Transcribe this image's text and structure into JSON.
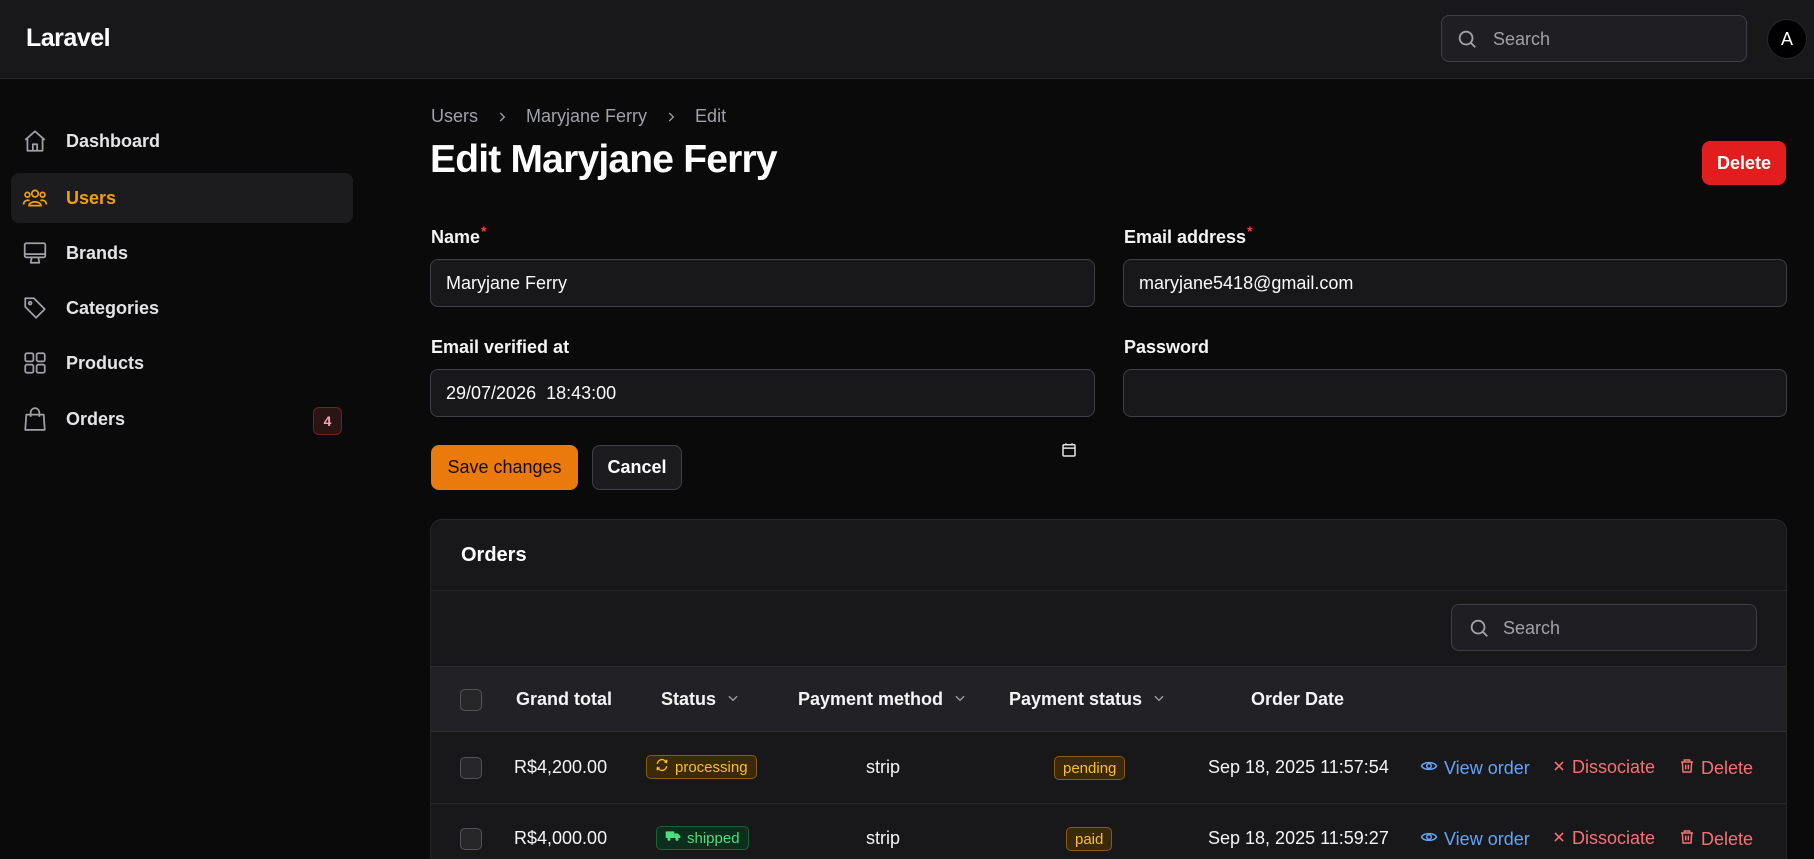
{
  "header": {
    "brand": "Laravel",
    "search_placeholder": "Search",
    "avatar_initial": "A"
  },
  "sidebar": {
    "items": [
      {
        "label": "Dashboard",
        "icon": "home-icon",
        "active": false
      },
      {
        "label": "Users",
        "icon": "users-icon",
        "active": true
      },
      {
        "label": "Brands",
        "icon": "monitor-icon",
        "active": false
      },
      {
        "label": "Categories",
        "icon": "tag-icon",
        "active": false
      },
      {
        "label": "Products",
        "icon": "grid-icon",
        "active": false
      },
      {
        "label": "Orders",
        "icon": "shopping-bag-icon",
        "active": false,
        "badge": "4"
      }
    ]
  },
  "breadcrumb": [
    "Users",
    "Maryjane Ferry",
    "Edit"
  ],
  "page": {
    "title": "Edit Maryjane Ferry",
    "delete_label": "Delete"
  },
  "form": {
    "name_label": "Name",
    "name_value": "Maryjane Ferry",
    "email_label": "Email address",
    "email_value": "maryjane5418@gmail.com",
    "verified_label": "Email verified at",
    "verified_value": "29/07/2026  18:43:00",
    "password_label": "Password",
    "password_value": "",
    "required_mark": "*",
    "save_label": "Save changes",
    "cancel_label": "Cancel"
  },
  "orders": {
    "title": "Orders",
    "search_placeholder": "Search",
    "columns": [
      "Grand total",
      "Status",
      "Payment method",
      "Payment status",
      "Order Date"
    ],
    "rows": [
      {
        "grand_total": "R$4,200.00",
        "status": "processing",
        "payment_method": "strip",
        "payment_status": "pending",
        "order_date": "Sep 18, 2025 11:57:54"
      },
      {
        "grand_total": "R$4,000.00",
        "status": "shipped",
        "payment_method": "strip",
        "payment_status": "paid",
        "order_date": "Sep 18, 2025 11:59:27"
      }
    ],
    "actions": {
      "view": "View order",
      "dissociate": "Dissociate",
      "delete": "Delete"
    }
  },
  "colors": {
    "accent": "#f59e0b",
    "danger": "#e11d1d",
    "link": "#60a5fa"
  }
}
